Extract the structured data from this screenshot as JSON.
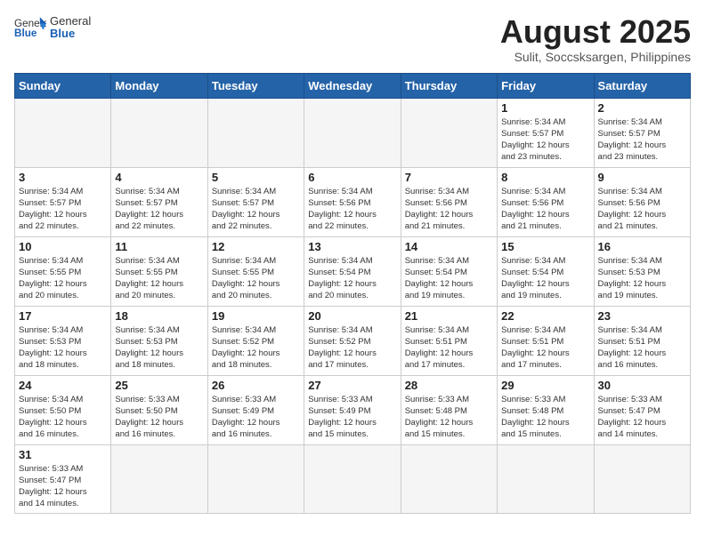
{
  "logo": {
    "text_general": "General",
    "text_blue": "Blue"
  },
  "title": "August 2025",
  "subtitle": "Sulit, Soccsksargen, Philippines",
  "weekdays": [
    "Sunday",
    "Monday",
    "Tuesday",
    "Wednesday",
    "Thursday",
    "Friday",
    "Saturday"
  ],
  "weeks": [
    [
      {
        "day": "",
        "info": ""
      },
      {
        "day": "",
        "info": ""
      },
      {
        "day": "",
        "info": ""
      },
      {
        "day": "",
        "info": ""
      },
      {
        "day": "",
        "info": ""
      },
      {
        "day": "1",
        "info": "Sunrise: 5:34 AM\nSunset: 5:57 PM\nDaylight: 12 hours\nand 23 minutes."
      },
      {
        "day": "2",
        "info": "Sunrise: 5:34 AM\nSunset: 5:57 PM\nDaylight: 12 hours\nand 23 minutes."
      }
    ],
    [
      {
        "day": "3",
        "info": "Sunrise: 5:34 AM\nSunset: 5:57 PM\nDaylight: 12 hours\nand 22 minutes."
      },
      {
        "day": "4",
        "info": "Sunrise: 5:34 AM\nSunset: 5:57 PM\nDaylight: 12 hours\nand 22 minutes."
      },
      {
        "day": "5",
        "info": "Sunrise: 5:34 AM\nSunset: 5:57 PM\nDaylight: 12 hours\nand 22 minutes."
      },
      {
        "day": "6",
        "info": "Sunrise: 5:34 AM\nSunset: 5:56 PM\nDaylight: 12 hours\nand 22 minutes."
      },
      {
        "day": "7",
        "info": "Sunrise: 5:34 AM\nSunset: 5:56 PM\nDaylight: 12 hours\nand 21 minutes."
      },
      {
        "day": "8",
        "info": "Sunrise: 5:34 AM\nSunset: 5:56 PM\nDaylight: 12 hours\nand 21 minutes."
      },
      {
        "day": "9",
        "info": "Sunrise: 5:34 AM\nSunset: 5:56 PM\nDaylight: 12 hours\nand 21 minutes."
      }
    ],
    [
      {
        "day": "10",
        "info": "Sunrise: 5:34 AM\nSunset: 5:55 PM\nDaylight: 12 hours\nand 20 minutes."
      },
      {
        "day": "11",
        "info": "Sunrise: 5:34 AM\nSunset: 5:55 PM\nDaylight: 12 hours\nand 20 minutes."
      },
      {
        "day": "12",
        "info": "Sunrise: 5:34 AM\nSunset: 5:55 PM\nDaylight: 12 hours\nand 20 minutes."
      },
      {
        "day": "13",
        "info": "Sunrise: 5:34 AM\nSunset: 5:54 PM\nDaylight: 12 hours\nand 20 minutes."
      },
      {
        "day": "14",
        "info": "Sunrise: 5:34 AM\nSunset: 5:54 PM\nDaylight: 12 hours\nand 19 minutes."
      },
      {
        "day": "15",
        "info": "Sunrise: 5:34 AM\nSunset: 5:54 PM\nDaylight: 12 hours\nand 19 minutes."
      },
      {
        "day": "16",
        "info": "Sunrise: 5:34 AM\nSunset: 5:53 PM\nDaylight: 12 hours\nand 19 minutes."
      }
    ],
    [
      {
        "day": "17",
        "info": "Sunrise: 5:34 AM\nSunset: 5:53 PM\nDaylight: 12 hours\nand 18 minutes."
      },
      {
        "day": "18",
        "info": "Sunrise: 5:34 AM\nSunset: 5:53 PM\nDaylight: 12 hours\nand 18 minutes."
      },
      {
        "day": "19",
        "info": "Sunrise: 5:34 AM\nSunset: 5:52 PM\nDaylight: 12 hours\nand 18 minutes."
      },
      {
        "day": "20",
        "info": "Sunrise: 5:34 AM\nSunset: 5:52 PM\nDaylight: 12 hours\nand 17 minutes."
      },
      {
        "day": "21",
        "info": "Sunrise: 5:34 AM\nSunset: 5:51 PM\nDaylight: 12 hours\nand 17 minutes."
      },
      {
        "day": "22",
        "info": "Sunrise: 5:34 AM\nSunset: 5:51 PM\nDaylight: 12 hours\nand 17 minutes."
      },
      {
        "day": "23",
        "info": "Sunrise: 5:34 AM\nSunset: 5:51 PM\nDaylight: 12 hours\nand 16 minutes."
      }
    ],
    [
      {
        "day": "24",
        "info": "Sunrise: 5:34 AM\nSunset: 5:50 PM\nDaylight: 12 hours\nand 16 minutes."
      },
      {
        "day": "25",
        "info": "Sunrise: 5:33 AM\nSunset: 5:50 PM\nDaylight: 12 hours\nand 16 minutes."
      },
      {
        "day": "26",
        "info": "Sunrise: 5:33 AM\nSunset: 5:49 PM\nDaylight: 12 hours\nand 16 minutes."
      },
      {
        "day": "27",
        "info": "Sunrise: 5:33 AM\nSunset: 5:49 PM\nDaylight: 12 hours\nand 15 minutes."
      },
      {
        "day": "28",
        "info": "Sunrise: 5:33 AM\nSunset: 5:48 PM\nDaylight: 12 hours\nand 15 minutes."
      },
      {
        "day": "29",
        "info": "Sunrise: 5:33 AM\nSunset: 5:48 PM\nDaylight: 12 hours\nand 15 minutes."
      },
      {
        "day": "30",
        "info": "Sunrise: 5:33 AM\nSunset: 5:47 PM\nDaylight: 12 hours\nand 14 minutes."
      }
    ],
    [
      {
        "day": "31",
        "info": "Sunrise: 5:33 AM\nSunset: 5:47 PM\nDaylight: 12 hours\nand 14 minutes."
      },
      {
        "day": "",
        "info": ""
      },
      {
        "day": "",
        "info": ""
      },
      {
        "day": "",
        "info": ""
      },
      {
        "day": "",
        "info": ""
      },
      {
        "day": "",
        "info": ""
      },
      {
        "day": "",
        "info": ""
      }
    ]
  ]
}
